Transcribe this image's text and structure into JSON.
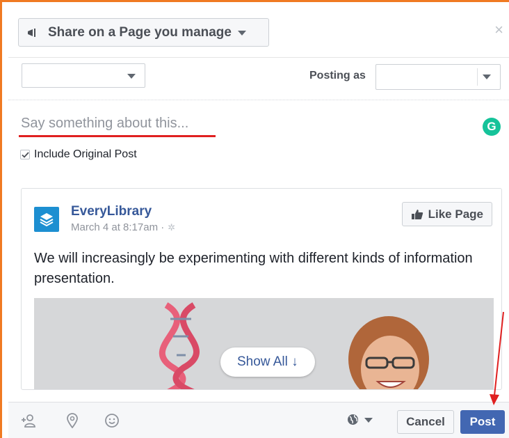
{
  "header": {
    "share_label": "Share on a Page you manage",
    "close_label": "×"
  },
  "posting": {
    "page_select_value": "",
    "posting_as_label": "Posting as",
    "posting_as_value": ""
  },
  "composer": {
    "placeholder": "Say something about this...",
    "grammarly_label": "G"
  },
  "include_original": {
    "checked": true,
    "label": "Include Original Post"
  },
  "post": {
    "page_name": "EveryLibrary",
    "timestamp": "March 4 at 8:17am · ",
    "like_button_label": "Like Page",
    "text": "We will increasingly be experimenting with different kinds of information presentation.",
    "show_all_label": "Show All ↓"
  },
  "footer": {
    "cancel_label": "Cancel",
    "post_label": "Post"
  },
  "colors": {
    "frame": "#f07a22",
    "annotation_red": "#e02020",
    "fb_blue": "#4267b2",
    "link_blue": "#365899",
    "grammarly_green": "#15c39a",
    "avatar_blue": "#1d8fd1"
  },
  "icons": [
    "megaphone-icon",
    "close-icon",
    "chevron-down-icon",
    "grammarly-icon",
    "checkmark-icon",
    "everylibrary-logo",
    "gear-icon",
    "thumbs-up-icon",
    "tag-friends-icon",
    "location-pin-icon",
    "emoji-icon",
    "globe-icon"
  ]
}
